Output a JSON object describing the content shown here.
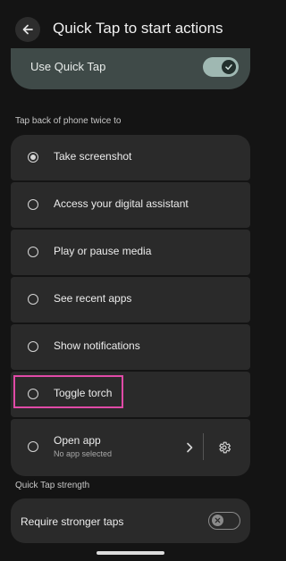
{
  "header": {
    "title": "Quick Tap to start actions",
    "back_icon": "arrow-left-icon"
  },
  "use_quick_tap": {
    "label": "Use Quick Tap",
    "enabled": true,
    "accent": "#9fb8b2"
  },
  "section_actions": {
    "label": "Tap back of phone twice to"
  },
  "options": [
    {
      "label": "Take screenshot",
      "selected": true
    },
    {
      "label": "Access your digital assistant",
      "selected": false
    },
    {
      "label": "Play or pause media",
      "selected": false
    },
    {
      "label": "See recent apps",
      "selected": false
    },
    {
      "label": "Show notifications",
      "selected": false
    },
    {
      "label": "Toggle torch",
      "selected": false,
      "highlighted": true
    },
    {
      "label": "Open app",
      "sublabel": "No app selected",
      "selected": false
    }
  ],
  "section_strength": {
    "label": "Quick Tap strength"
  },
  "stronger_taps": {
    "label": "Require stronger taps",
    "enabled": false
  },
  "highlight_color": "#e04aa7"
}
